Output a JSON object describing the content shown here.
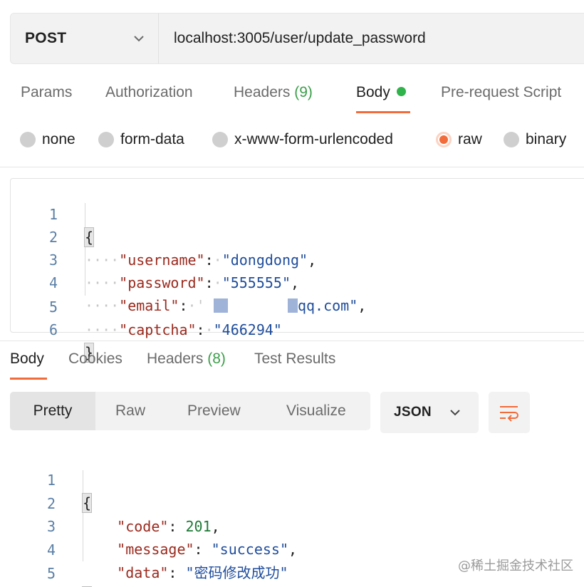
{
  "request": {
    "method": "POST",
    "url": "localhost:3005/user/update_password"
  },
  "request_tabs": [
    {
      "label": "Params"
    },
    {
      "label": "Authorization"
    },
    {
      "label": "Headers",
      "count": "(9)"
    },
    {
      "label": "Body",
      "active": true
    },
    {
      "label": "Pre-request Script"
    }
  ],
  "body_modes": [
    "none",
    "form-data",
    "x-www-form-urlencoded",
    "raw",
    "binary"
  ],
  "body_mode_selected": "raw",
  "request_body": {
    "line_numbers": [
      "1",
      "2",
      "3",
      "4",
      "5",
      "6"
    ],
    "open_brace": "{",
    "close_brace": "}",
    "username_key": "\"username\"",
    "username_value": "\"dongdong\"",
    "password_key": "\"password\"",
    "password_value": "\"555555\"",
    "email_key": "\"email\"",
    "email_value_visible": "qq.com\"",
    "captcha_key": "\"captcha\"",
    "captcha_value": "\"466294\""
  },
  "response_tabs": [
    {
      "label": "Body",
      "active": true
    },
    {
      "label": "Cookies"
    },
    {
      "label": "Headers",
      "count": "(8)"
    },
    {
      "label": "Test Results"
    }
  ],
  "view_modes": [
    "Pretty",
    "Raw",
    "Preview",
    "Visualize"
  ],
  "view_mode_selected": "Pretty",
  "format": "JSON",
  "response_body": {
    "line_numbers": [
      "1",
      "2",
      "3",
      "4",
      "5"
    ],
    "open_brace": "{",
    "close_brace": "}",
    "code_key": "\"code\"",
    "code_value": "201",
    "message_key": "\"message\"",
    "message_value": "\"success\"",
    "data_key": "\"data\"",
    "data_value": "\"密码修改成功\""
  },
  "watermark": "@稀土掘金技术社区",
  "colors": {
    "accent": "#f26b3a",
    "success_dot": "#2fb34a",
    "count": "#3c9e4a",
    "json_key": "#9a2a1e",
    "json_string": "#1f4d9c",
    "json_number": "#1e7a36"
  }
}
